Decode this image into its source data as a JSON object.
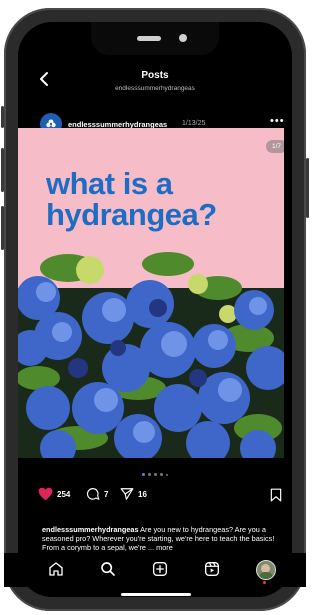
{
  "header": {
    "title": "Posts",
    "subtitle": "endlesssummerhydrangeas"
  },
  "post": {
    "username": "endlesssummerhydrangeas",
    "date": "1/13/25",
    "image_counter": "1/7",
    "headline_line1": "what is a",
    "headline_line2": "hydrangea?",
    "likes": "254",
    "comments": "7",
    "shares": "16",
    "caption_user": "endlesssummerhydrangeas",
    "caption_text": " Are you new to hydrangeas? Are you a seasoned pro? Wherever you're starting, we're here to teach the basics! From a corymb to a sepal, we're ... more"
  },
  "colors": {
    "heart": "#e0245e",
    "headline": "#1e6dc4",
    "pink_bg": "#f6bdc9",
    "active_dot": "#3b8ded"
  },
  "icons": [
    "back-icon",
    "more-icon",
    "heart-icon",
    "comment-icon",
    "share-icon",
    "bookmark-icon",
    "home-icon",
    "search-icon",
    "create-icon",
    "reels-icon",
    "profile-avatar"
  ]
}
